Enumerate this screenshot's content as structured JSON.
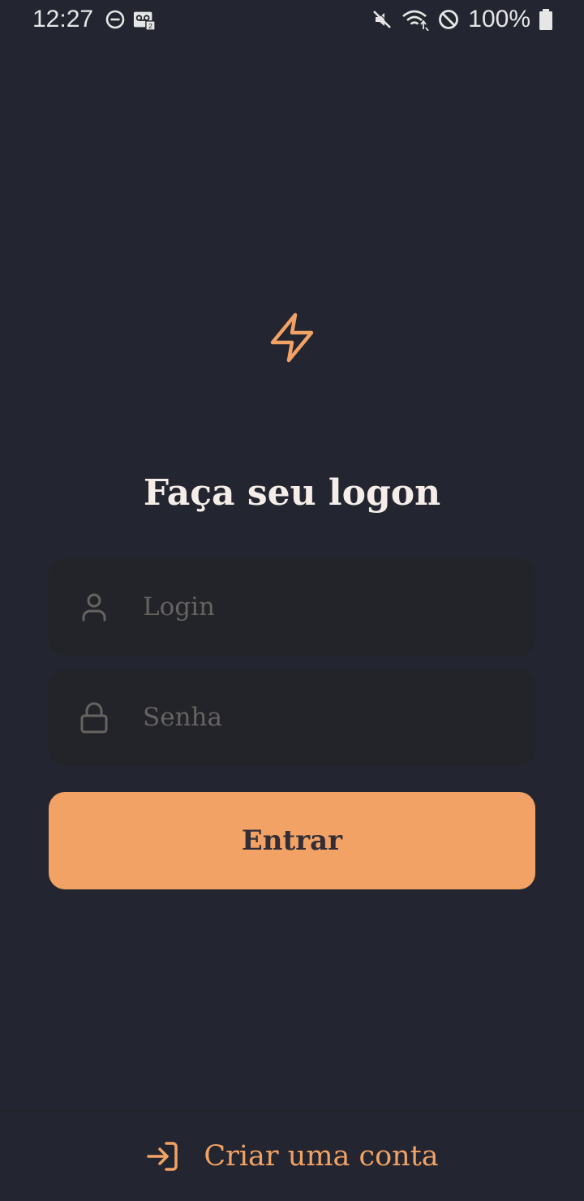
{
  "status_bar": {
    "time": "12:27",
    "battery_percent": "100%",
    "icons": [
      "dnd-icon",
      "voicemail-icon",
      "mute-icon",
      "wifi-icon",
      "blocked-icon",
      "battery-icon"
    ]
  },
  "logo": {
    "icon": "lightning-icon",
    "color": "#f2a264"
  },
  "login_form": {
    "title": "Faça seu logon",
    "login_field": {
      "placeholder": "Login",
      "value": "",
      "icon": "user-icon"
    },
    "password_field": {
      "placeholder": "Senha",
      "value": "",
      "icon": "lock-icon"
    },
    "submit_label": "Entrar"
  },
  "footer": {
    "create_account_label": "Criar uma conta",
    "icon": "log-in-icon"
  },
  "colors": {
    "background": "#232630",
    "input_background": "#22242a",
    "accent": "#f2a264",
    "text": "#f4ede8",
    "placeholder": "#666360",
    "button_text": "#312e38"
  }
}
